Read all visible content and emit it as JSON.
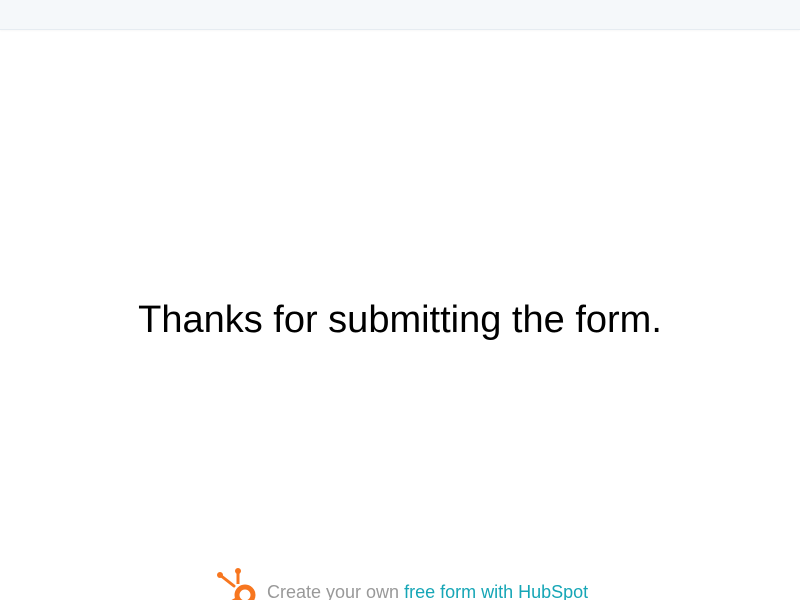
{
  "confirmation": {
    "message": "Thanks for submitting the form."
  },
  "footer": {
    "logo_icon": "hubspot-sprocket-icon",
    "text": "Create your own ",
    "link_label": "free form with HubSpot",
    "link_color": "#16a6b6",
    "logo_color": "#f7761f"
  }
}
